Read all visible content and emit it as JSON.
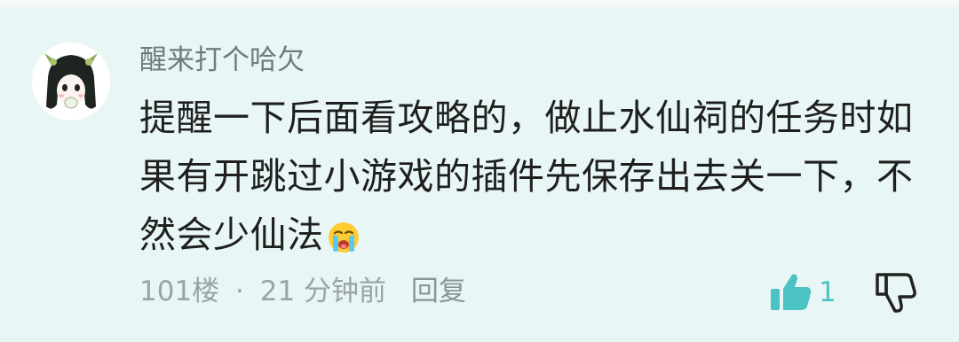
{
  "comment": {
    "username": "醒来打个哈欠",
    "text_lines": [
      "提醒一下后面看攻略的，做止水仙祠的任务时如",
      "果有开跳过小游戏的插件先保存出去关一下，不",
      "然会少仙法"
    ],
    "emoji": "crying-face-emoji",
    "floor": "101楼",
    "separator": "·",
    "time": "21 分钟前",
    "reply_label": "回复",
    "like_count": "1"
  },
  "colors": {
    "background": "#e9f6f6",
    "accent": "#4cc2c4",
    "text": "#1f1f1f",
    "muted": "#9aa4a5"
  }
}
